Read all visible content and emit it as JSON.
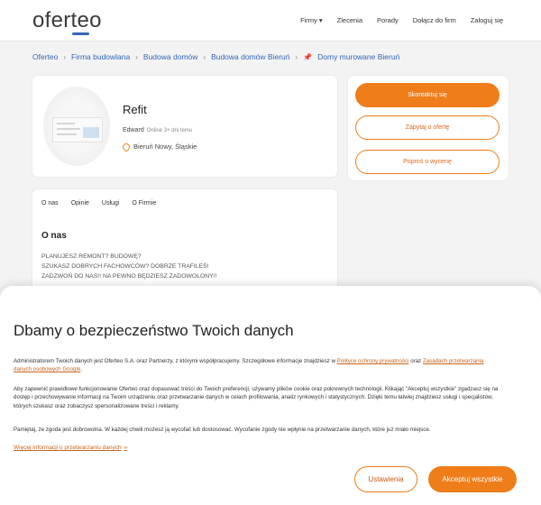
{
  "header": {
    "logo": "oferteo",
    "nav": [
      "Firmy ▾",
      "Zlecenia",
      "Porady",
      "Dołącz do firm",
      "Zaloguj się"
    ]
  },
  "breadcrumb": [
    "Oferteo",
    "Firma budowlana",
    "Budowa domów",
    "Budowa domów Bieruń",
    "Domy murowane Bieruń"
  ],
  "profile": {
    "name": "Refit",
    "owner": "Edward",
    "online": "Online 3+ dni temu",
    "location": "Bieruń Nowy, Śląskie"
  },
  "contact": {
    "primary": "Skontaktuj się",
    "ask": "Zapytaj o ofertę",
    "quote": "Poproś o wycenę"
  },
  "about": {
    "tabs": [
      "O nas",
      "Opinie",
      "Usługi",
      "O Firmie"
    ],
    "title": "O nas",
    "lines": [
      "PLANUJESZ REMONT? BUDOWĘ?",
      "SZUKASZ DOBRYCH FACHOWCÓW? DOBRZE TRAFILEŚ!",
      "ZADZWOŃ DO NAS!! NA PEWNO BĘDZIESZ ZADOWOLONY!!"
    ]
  },
  "consent": {
    "title": "Dbamy o bezpieczeństwo Twoich danych",
    "p1_a": "Administratorem Twoich danych jest Oferteo S.A. oraz Partnerzy, z którymi współpracujemy. Szczegółowe informacje znajdziesz w ",
    "p1_link1": "Polityce ochrony prywatności",
    "p1_b": " oraz ",
    "p1_link2": "Zasadach przetwarzania danych osobowych Google",
    "p1_c": ".",
    "p2": "Aby zapewnić prawidłowe funkcjonowanie Oferteo oraz dopasować treści do Twoich preferencji, używamy plików cookie oraz pokrewnych technologii. Klikając \"Akceptuj wszystkie\" zgadzasz się na dostęp i przechowywanie informacji na Twoim urządzeniu oraz przetwarzanie danych w celach profilowania, analiz rynkowych i statystycznych. Dzięki temu łatwiej znajdziesz usługi i specjalistów, których szukasz oraz zobaczysz spersonalizowane treści i reklamy.",
    "p3": "Pamiętaj, że zgoda jest dobrowolna. W każdej chwili możesz ją wycofać lub dostosować. Wycofanie zgody nie wpłynie na przetwarzanie danych, które już miało miejsce.",
    "more": "Więcej informacji o przetwarzaniu danych",
    "more_chevron": "»",
    "settings": "Ustawienia",
    "accept": "Akceptuj wszystkie"
  },
  "colors": {
    "accent": "#ef7d1a",
    "link": "#3566b6"
  }
}
